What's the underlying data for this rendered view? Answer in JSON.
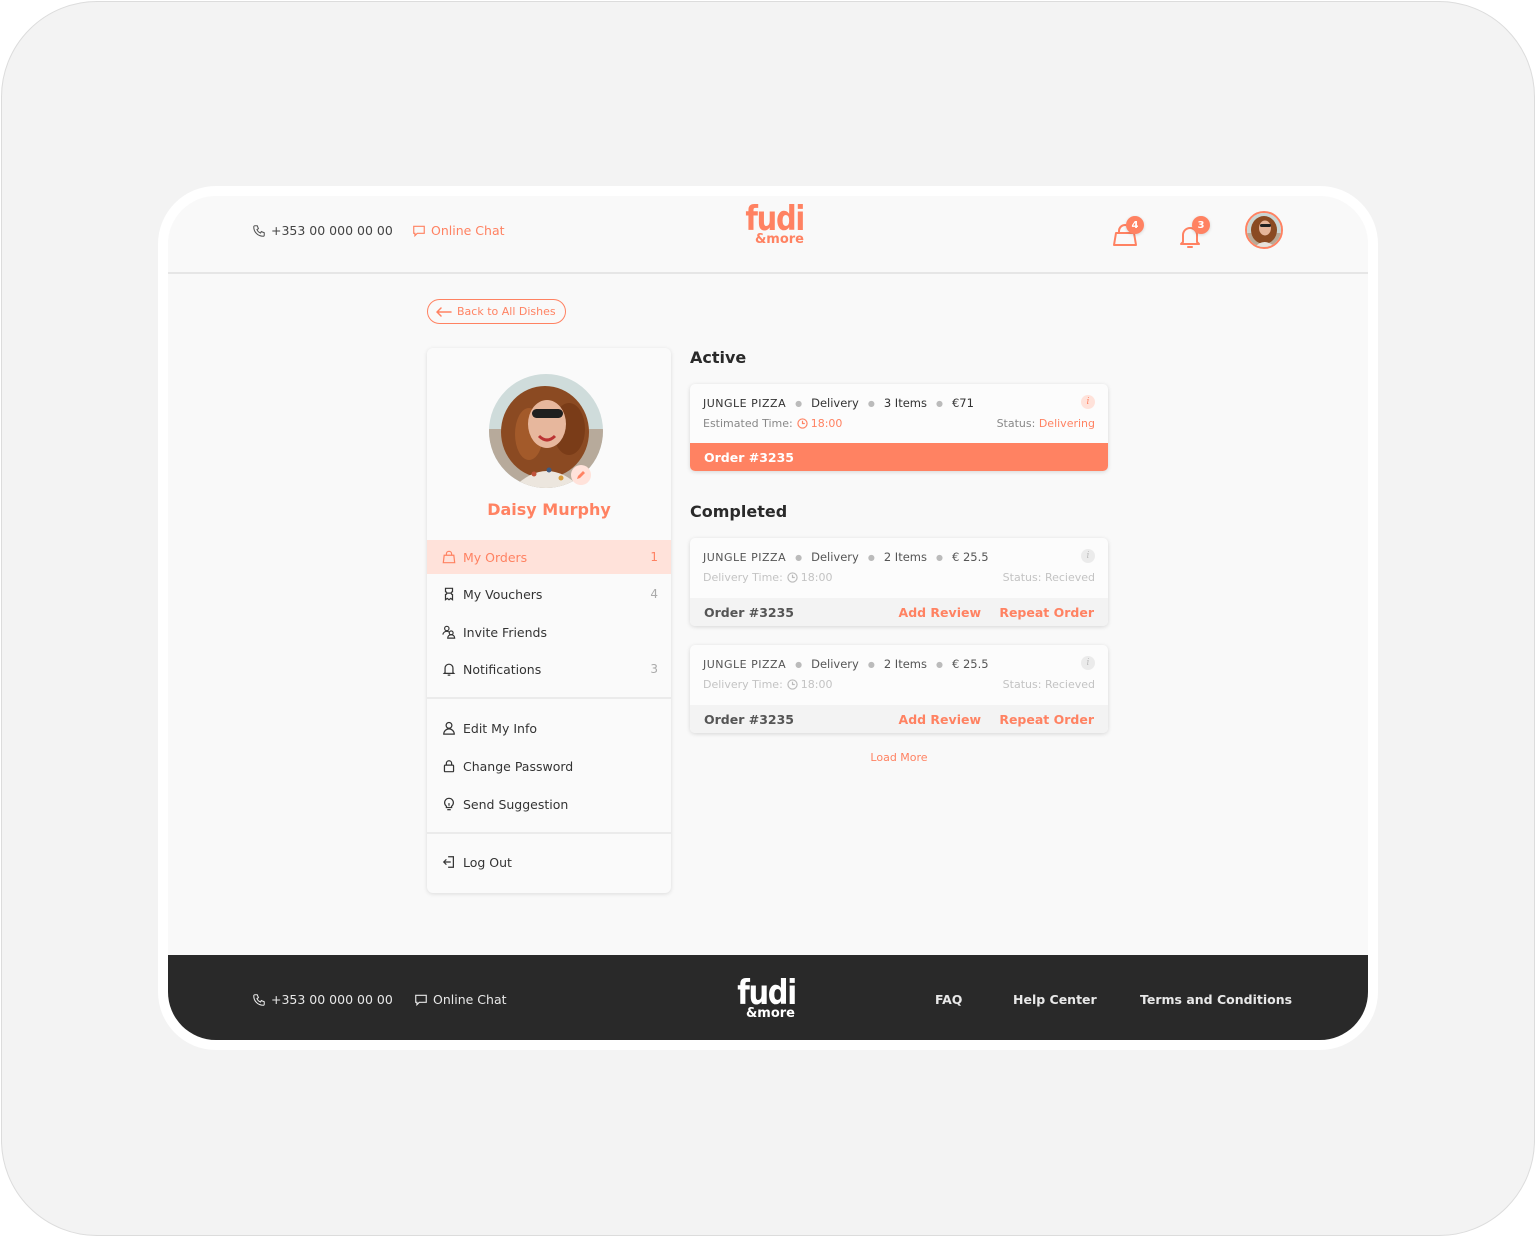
{
  "header": {
    "phone": "+353 00 000 00 00",
    "chat_label": "Online Chat",
    "logo_main": "fudi",
    "logo_sub": "&more",
    "cart_count": "4",
    "notification_count": "3"
  },
  "back_button": {
    "label": "Back to All Dishes"
  },
  "profile": {
    "name": "Daisy Murphy",
    "menu": [
      {
        "label": "My Orders",
        "count": "1",
        "icon": "bag-icon",
        "active": true
      },
      {
        "label": "My Vouchers",
        "count": "4",
        "icon": "voucher-icon"
      },
      {
        "label": "Invite Friends",
        "count": "",
        "icon": "users-icon"
      },
      {
        "label": "Notifications",
        "count": "3",
        "icon": "bell-icon"
      }
    ],
    "account_menu": [
      {
        "label": "Edit My Info",
        "icon": "user-icon"
      },
      {
        "label": "Change Password",
        "icon": "lock-icon"
      },
      {
        "label": "Send Suggestion",
        "icon": "lightbulb-icon"
      }
    ],
    "logout_label": "Log Out"
  },
  "orders": {
    "active_title": "Active",
    "completed_title": "Completed",
    "active": [
      {
        "restaurant": "JUNGLE PIZZA",
        "type": "Delivery",
        "items": "3 Items",
        "price": "€71",
        "time_label": "Estimated Time:",
        "time": "18:00",
        "status_label": "Status:",
        "status": "Delivering",
        "order_id": "Order #3235"
      }
    ],
    "completed": [
      {
        "restaurant": "JUNGLE PIZZA",
        "type": "Delivery",
        "items": "2 Items",
        "price": "€ 25.5",
        "time_label": "Delivery Time:",
        "time": "18:00",
        "status_label": "Status:",
        "status": "Recieved",
        "order_id": "Order #3235",
        "review_label": "Add Review",
        "repeat_label": "Repeat Order"
      },
      {
        "restaurant": "JUNGLE PIZZA",
        "type": "Delivery",
        "items": "2 Items",
        "price": "€ 25.5",
        "time_label": "Delivery Time:",
        "time": "18:00",
        "status_label": "Status:",
        "status": "Recieved",
        "order_id": "Order #3235",
        "review_label": "Add Review",
        "repeat_label": "Repeat Order"
      }
    ],
    "load_more_label": "Load More",
    "info_glyph": "i"
  },
  "footer": {
    "phone": "+353 00 000 00 00",
    "chat_label": "Online Chat",
    "logo_main": "fudi",
    "logo_sub": "&more",
    "links": [
      "FAQ",
      "Help Center",
      "Terms and Conditions"
    ]
  },
  "colors": {
    "accent": "#ff8262",
    "accent_light": "#ffe2da",
    "footer_bg": "#292929",
    "page_bg": "#f9f9f9"
  }
}
